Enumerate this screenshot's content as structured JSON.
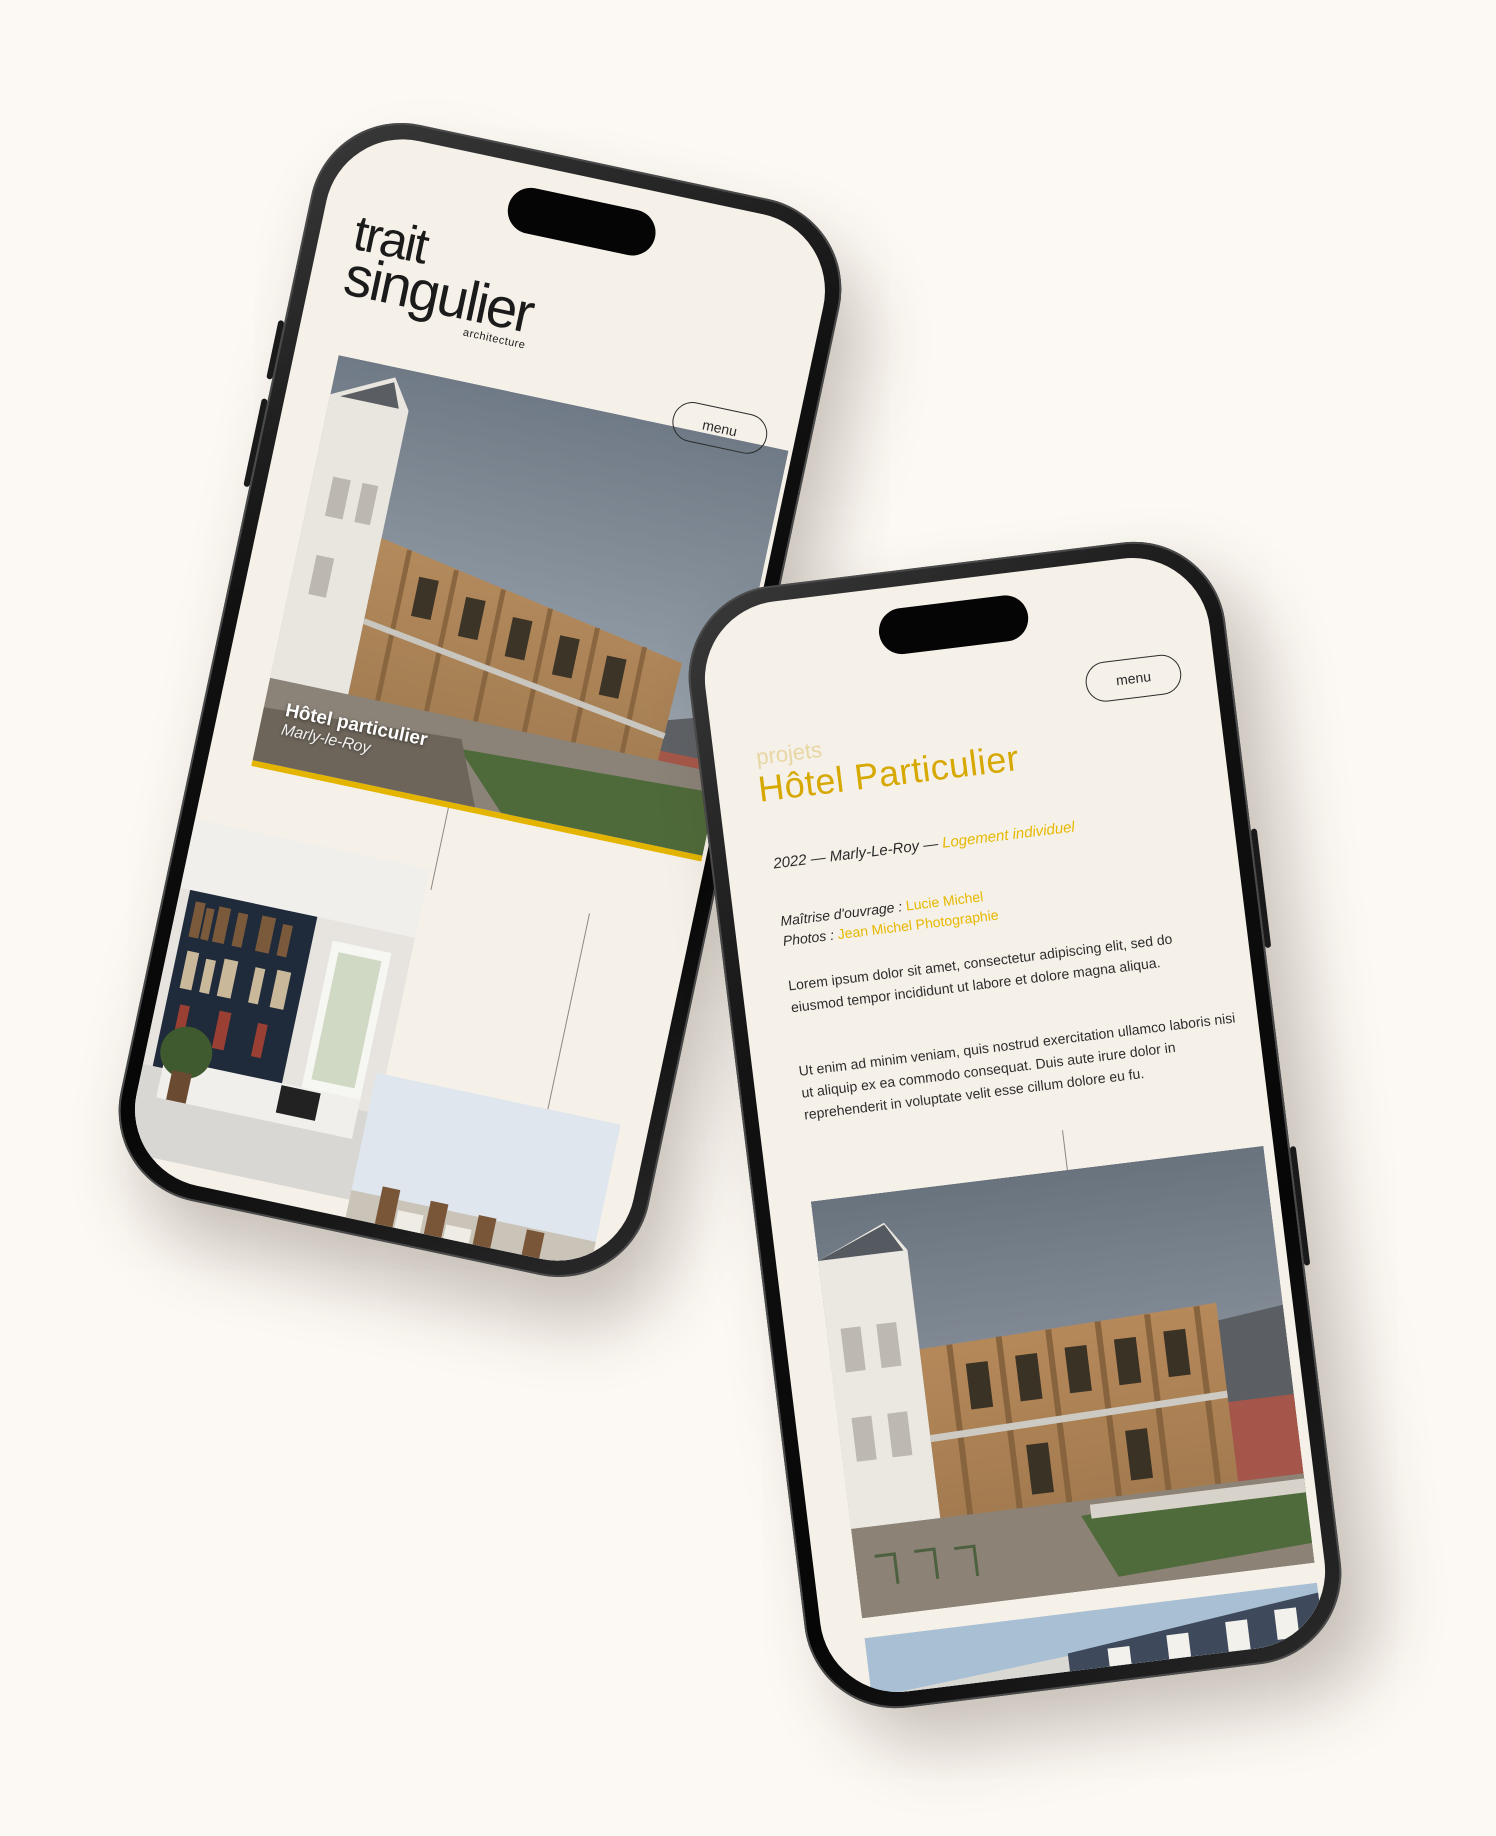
{
  "phone_left": {
    "logo": {
      "line1": "trait",
      "line2": "singulier",
      "line3": "architecture"
    },
    "menu_label": "menu",
    "project_card": {
      "title": "Hôtel particulier",
      "location": "Marly-le-Roy"
    }
  },
  "phone_right": {
    "menu_label": "menu",
    "breadcrumb": "projets",
    "title": "Hôtel Particulier",
    "meta": {
      "year": "2022",
      "separator": "—",
      "location": "Marly-Le-Roy",
      "category": "Logement individuel"
    },
    "credits": {
      "owner_label": "Maîtrise d'ouvrage :",
      "owner_value": "Lucie Michel",
      "photos_label": "Photos :",
      "photos_value": "Jean Michel Photographie"
    },
    "paragraphs": [
      "Lorem ipsum dolor sit amet, consectetur adipiscing elit, sed do eiusmod tempor incididunt ut labore et dolore magna aliqua.",
      "Ut enim ad minim veniam, quis nostrud exercitation ullamco laboris nisi ut aliquip ex ea commodo consequat. Duis aute irure dolor in reprehenderit in voluptate velit esse cillum dolore eu fu."
    ]
  },
  "colors": {
    "background": "#fcf8f3",
    "screen": "#f5f0e8",
    "accent": "#e3b400",
    "text": "#1b1b1b"
  }
}
